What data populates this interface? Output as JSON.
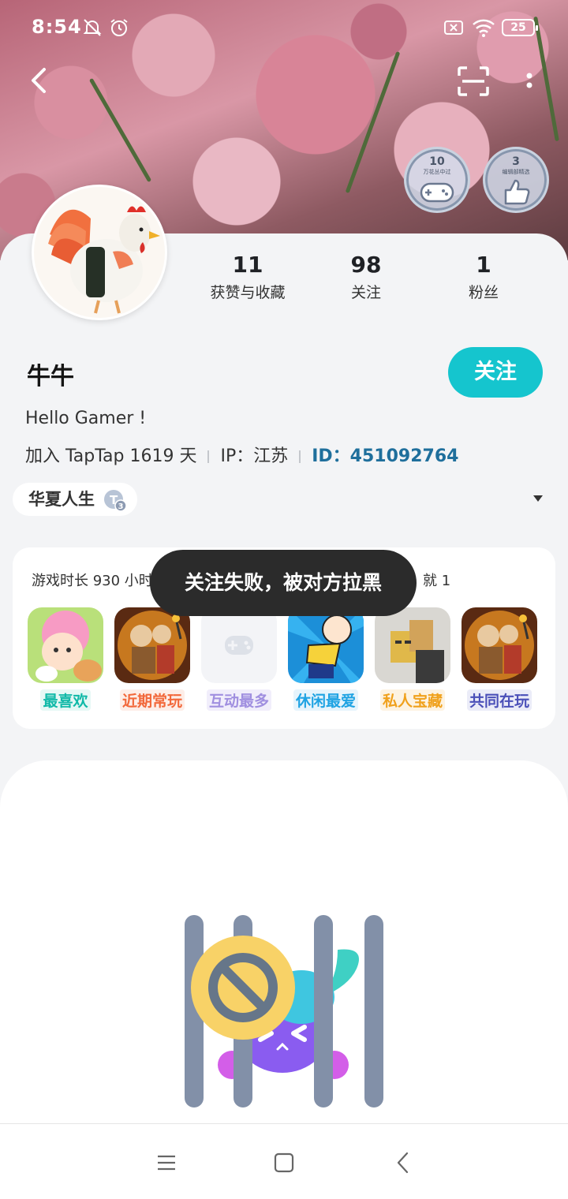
{
  "status_bar": {
    "time": "8:54",
    "battery": "25"
  },
  "badges": [
    {
      "number": "10",
      "caption": "万花丛中过"
    },
    {
      "number": "3",
      "caption": "编辑部精选"
    }
  ],
  "profile": {
    "stats": [
      {
        "value": "11",
        "label": "获赞与收藏"
      },
      {
        "value": "98",
        "label": "关注"
      },
      {
        "value": "1",
        "label": "粉丝"
      }
    ],
    "name": "牛牛",
    "follow_label": "关注",
    "bio": "Hello Gamer !",
    "join_text": "加入 TapTap 1619 天",
    "ip_text": "IP：江苏",
    "id_text": "ID：451092764",
    "title_chip": "华夏人生"
  },
  "games": {
    "summary_left": "游戏时长 930 小时",
    "summary_right": "就 1",
    "items": [
      {
        "label": "最喜欢",
        "color": "#10b9a8",
        "bg": "#e6f8f5"
      },
      {
        "label": "近期常玩",
        "color": "#f2683a",
        "bg": "#fdeee8"
      },
      {
        "label": "互动最多",
        "color": "#a08fe0",
        "bg": "#f1eefb"
      },
      {
        "label": "休闲最爱",
        "color": "#1fa3e3",
        "bg": "#e6f4fc"
      },
      {
        "label": "私人宝藏",
        "color": "#f0a11c",
        "bg": "#fdf3e2"
      },
      {
        "label": "共同在玩",
        "color": "#4a4fb8",
        "bg": "#ebecf8"
      }
    ]
  },
  "toast": "关注失败，被对方拉黑",
  "colors": {
    "accent": "#15c5ce",
    "id_blue": "#1f6f9c"
  },
  "icons": [
    "back-icon",
    "scan-icon",
    "more-icon",
    "bell-off-icon",
    "alarm-icon",
    "wifi-icon",
    "sim-off-icon",
    "menu-icon",
    "home-icon",
    "nav-back-icon"
  ]
}
